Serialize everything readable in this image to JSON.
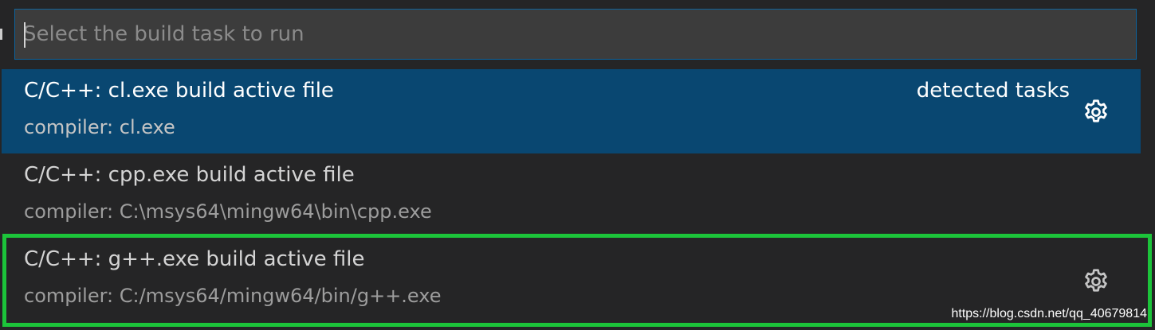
{
  "quick_pick": {
    "search": {
      "placeholder": "Select the build task to run",
      "value": ""
    },
    "items": [
      {
        "label": "C/C++: cl.exe build active file",
        "detail": "compiler: cl.exe",
        "group": "detected tasks",
        "selected": true,
        "icon": "gear-icon"
      },
      {
        "label": "C/C++: cpp.exe build active file",
        "detail": "compiler: C:\\msys64\\mingw64\\bin\\cpp.exe",
        "group": "",
        "selected": false,
        "icon": ""
      },
      {
        "label": "C/C++: g++.exe build active file",
        "detail": "compiler: C:/msys64/mingw64/bin/g++.exe",
        "group": "",
        "selected": false,
        "icon": "gear-icon"
      }
    ]
  },
  "annotation": {
    "highlight_color": "#1cc43a"
  },
  "watermark": "https://blog.csdn.net/qq_40679814",
  "colors": {
    "background": "#252526",
    "input_border": "#0e639c",
    "selected_background": "#094771"
  }
}
